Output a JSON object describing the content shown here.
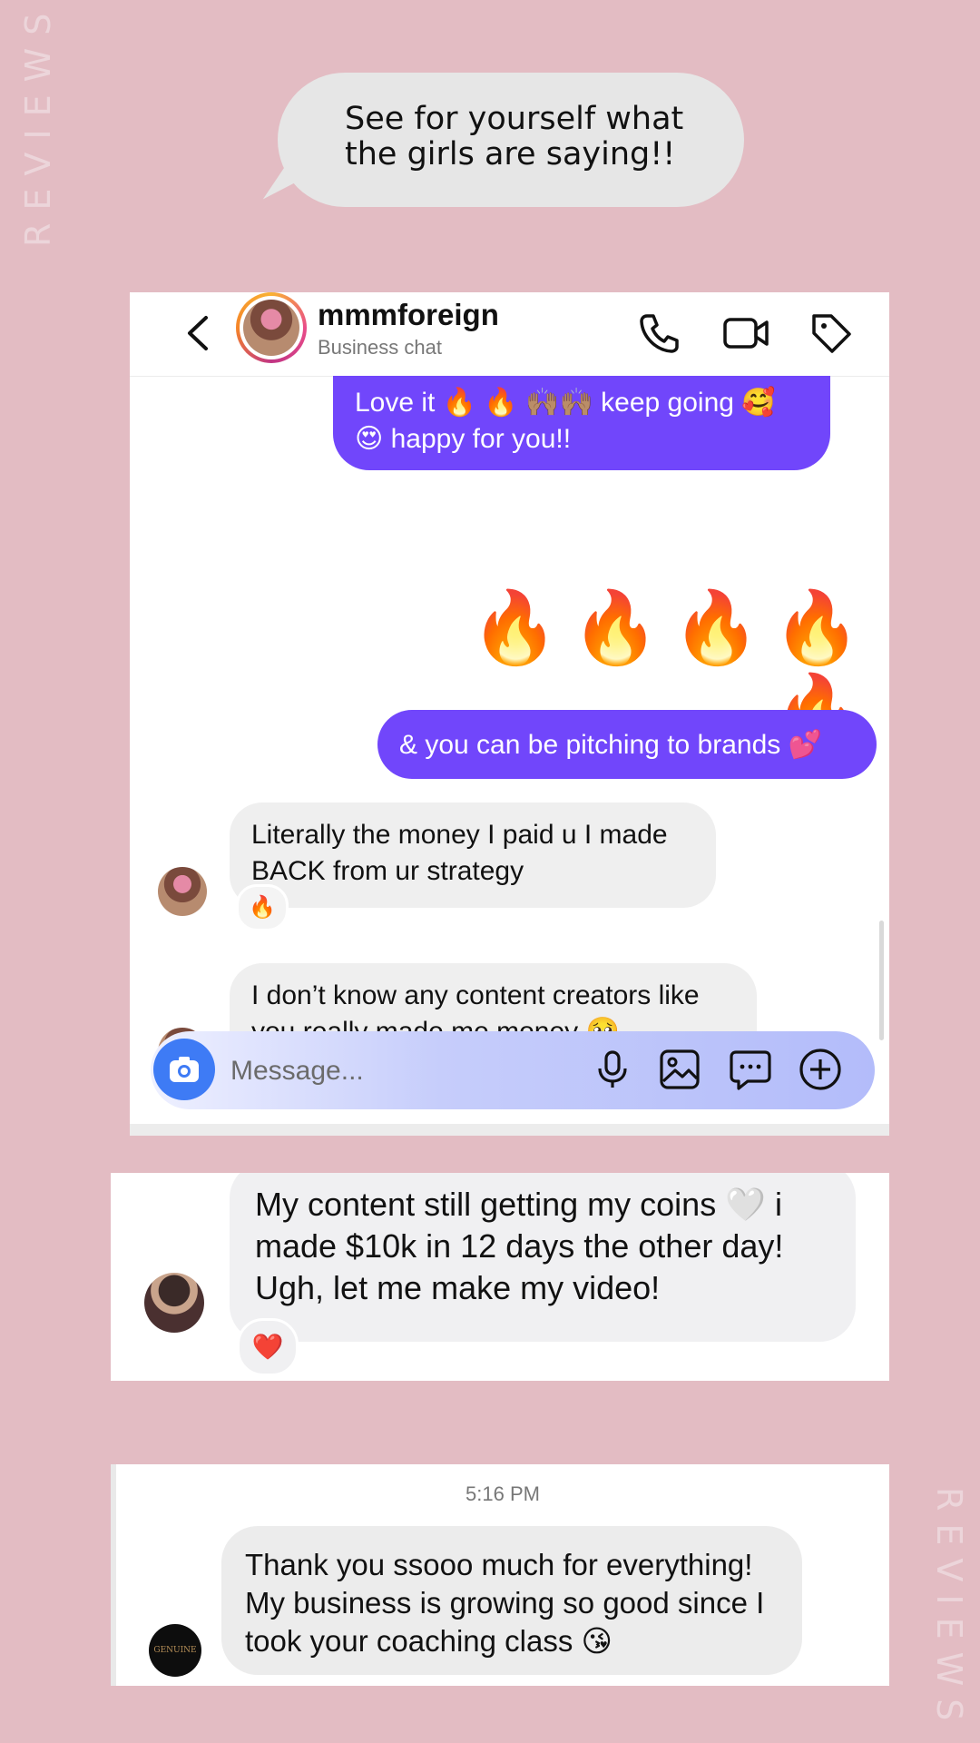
{
  "side_label": "REVIEWS",
  "intro_bubble": "See for yourself what the girls are saying!!",
  "chat": {
    "username": "mmmforeign",
    "subtitle": "Business chat",
    "messages": [
      {
        "from": "me",
        "text": "Love it 🔥 🔥 🙌🏽🙌🏽 keep going 🥰 😍 happy for you!!"
      },
      {
        "from": "me",
        "text": "🔥🔥🔥🔥🔥"
      },
      {
        "from": "me",
        "text": "& you can be pitching to brands 💕"
      },
      {
        "from": "them",
        "text": "Literally the money I paid u I made BACK from ur strategy",
        "reaction": "🔥"
      },
      {
        "from": "them",
        "text": "I don’t know any content creators like you really made me money 🥹",
        "reaction": "❤️"
      }
    ],
    "composer": {
      "placeholder": "Message..."
    }
  },
  "review2": {
    "text": "My content still getting my coins 🤍 i made $10k in 12 days the other day! Ugh, let me make my video!",
    "reaction": "❤️"
  },
  "review3": {
    "time": "5:16 PM",
    "text": "Thank you ssooo much for everything! My business is growing so good since I took your coaching class 😘",
    "avatar_text": "GENUINE Co."
  },
  "icons": [
    "back-icon",
    "phone-icon",
    "video-icon",
    "tag-icon",
    "camera-icon",
    "microphone-icon",
    "gallery-icon",
    "sticker-icon",
    "plus-icon"
  ]
}
